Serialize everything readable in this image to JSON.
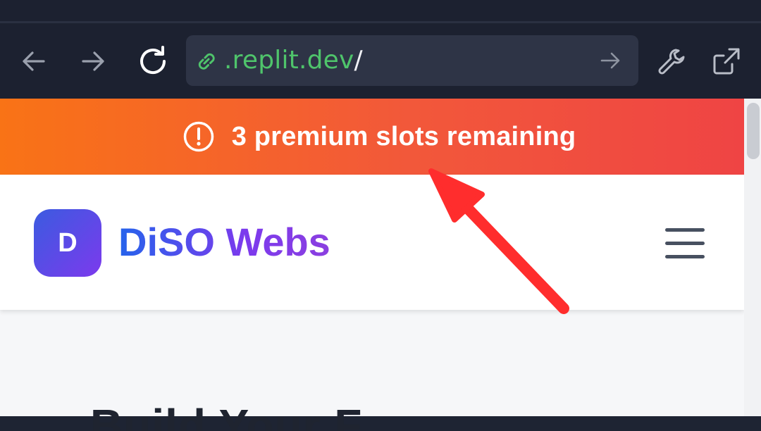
{
  "browser": {
    "back_icon": "arrow-left-icon",
    "forward_icon": "arrow-right-icon",
    "reload_icon": "reload-icon",
    "url": {
      "domain": ".replit.dev",
      "path": "/"
    },
    "devtools_icon": "wrench-icon",
    "open_external_icon": "external-link-icon"
  },
  "banner": {
    "icon": "alert-circle-icon",
    "text": "3 premium slots remaining",
    "colors": [
      "#f97316",
      "#ef4444"
    ]
  },
  "header": {
    "logo_letter": "D",
    "brand_name": "DiSO Webs",
    "menu_icon": "hamburger-menu-icon",
    "brand_colors": [
      "#2563eb",
      "#7c3aed"
    ]
  },
  "hero": {
    "heading_partial": "Build Your F"
  },
  "annotation": {
    "type": "red-arrow",
    "color": "#ff2d2d",
    "points_to": "banner"
  }
}
